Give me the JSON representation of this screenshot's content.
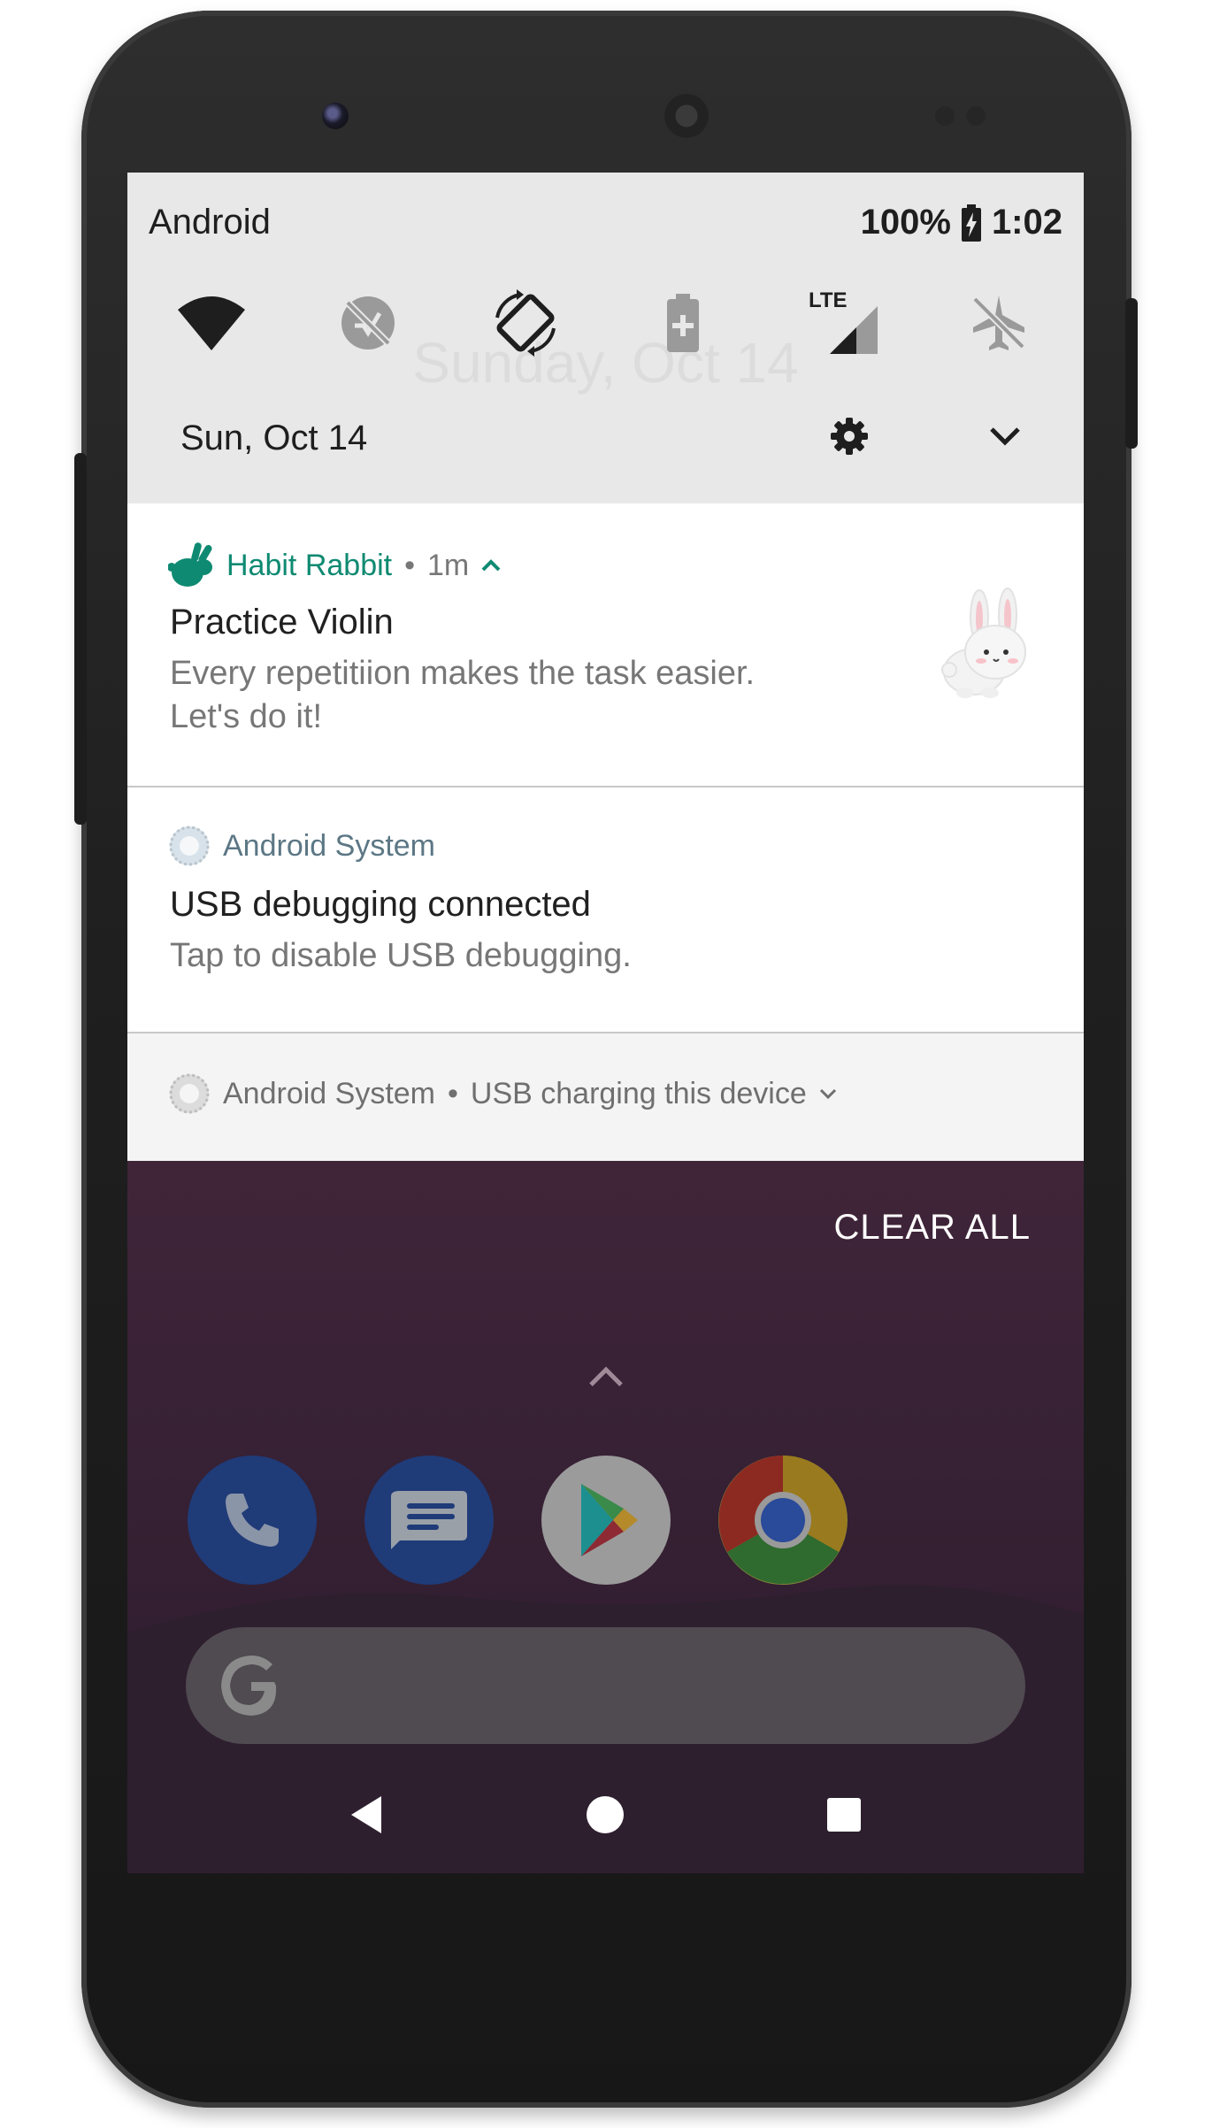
{
  "status_bar": {
    "carrier": "Android",
    "battery": "100%",
    "time": "1:02"
  },
  "quick_settings": {
    "tiles": [
      {
        "name": "wifi-icon"
      },
      {
        "name": "location-off-icon"
      },
      {
        "name": "auto-rotate-icon"
      },
      {
        "name": "battery-saver-icon"
      },
      {
        "name": "mobile-data-icon",
        "label": "LTE"
      },
      {
        "name": "airplane-mode-icon"
      }
    ],
    "ghost_date": "Sunday, Oct 14",
    "date": "Sun, Oct 14"
  },
  "notifications": [
    {
      "app": "Habit Rabbit",
      "time": "1m",
      "title": "Practice Violin",
      "text_line1": "Every repetitiion makes the task easier.",
      "text_line2": "Let's do it!",
      "app_color": "#0f8a72"
    },
    {
      "app": "Android System",
      "title": "USB debugging connected",
      "text": "Tap to disable USB debugging.",
      "app_color": "#5c7785"
    },
    {
      "app": "Android System",
      "summary": "USB charging this device"
    }
  ],
  "clear_all": "CLEAR ALL",
  "dock": [
    {
      "name": "phone-app-icon"
    },
    {
      "name": "messages-app-icon"
    },
    {
      "name": "play-store-app-icon"
    },
    {
      "name": "chrome-app-icon"
    }
  ],
  "nav": [
    "back",
    "home",
    "recents"
  ]
}
